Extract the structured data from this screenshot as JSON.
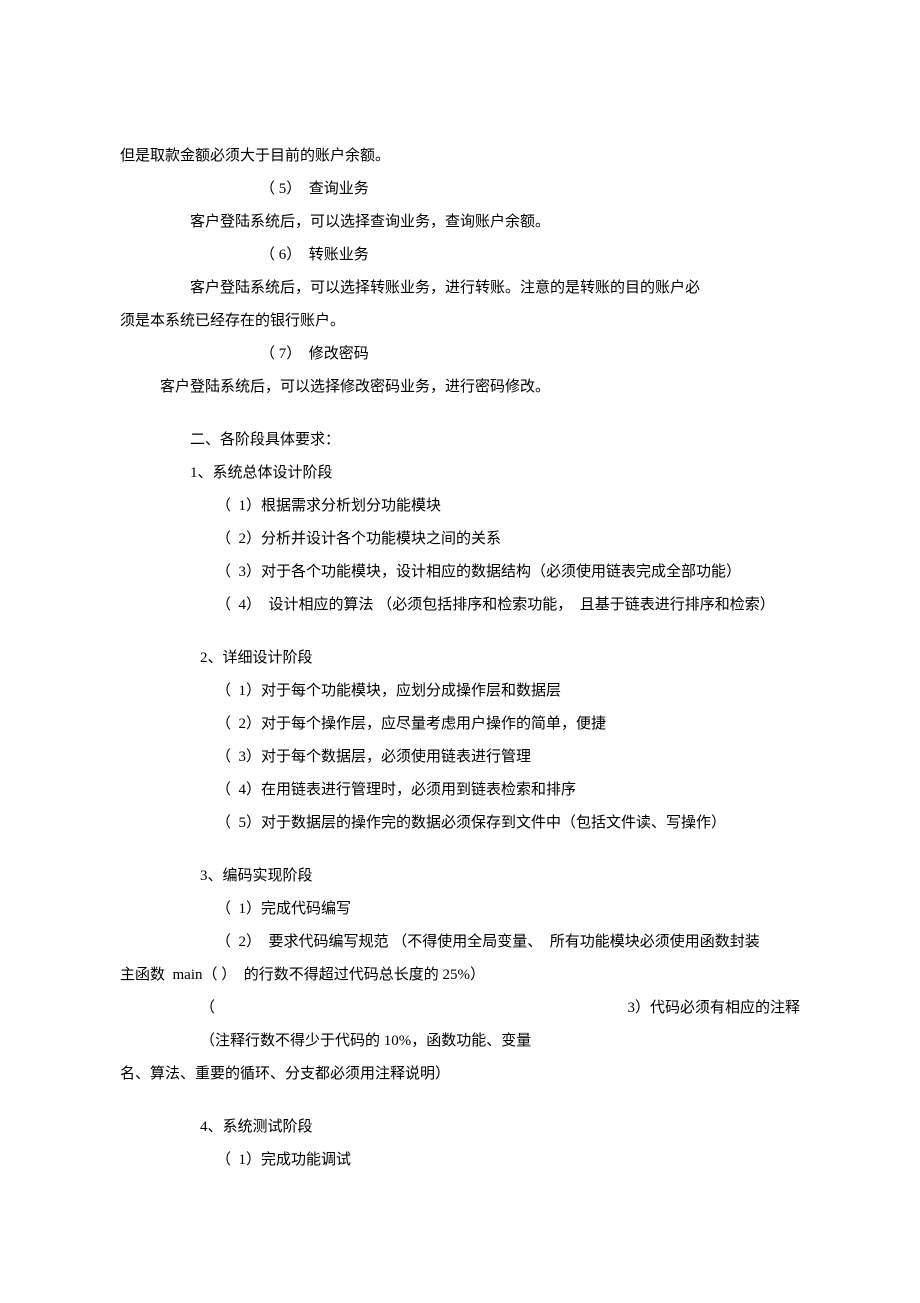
{
  "p1": "但是取款金额必须大于目前的账户余额。",
  "h5": "（ 5）  查询业务",
  "p2": "客户登陆系统后，可以选择查询业务，查询账户余额。",
  "h6": "（ 6）  转账业务",
  "p3a": "客户登陆系统后，可以选择转账业务，进行转账。注意的是转账的目的账户必",
  "p3b": "须是本系统已经存在的银行账户。",
  "h7": "（ 7）  修改密码",
  "p4": "客户登陆系统后，可以选择修改密码业务，进行密码修改。",
  "sec2": "二、各阶段具体要求：",
  "s1": "1、系统总体设计阶段",
  "s1_1": "（  1）根据需求分析划分功能模块",
  "s1_2": "（  2）分析并设计各个功能模块之间的关系",
  "s1_3": "（  3）对于各个功能模块，设计相应的数据结构（必须使用链表完成全部功能）",
  "s1_4": "（  4）  设计相应的算法 （必须包括排序和检索功能，  且基于链表进行排序和检索）",
  "s2": "2、详细设计阶段",
  "s2_1": "（  1）对于每个功能模块，应划分成操作层和数据层",
  "s2_2": "（  2）对于每个操作层，应尽量考虑用户操作的简单，便捷",
  "s2_3": "（  3）对于每个数据层，必须使用链表进行管理",
  "s2_4": "（  4）在用链表进行管理时，必须用到链表检索和排序",
  "s2_5": "（  5）对于数据层的操作完的数据必须保存到文件中（包括文件读、写操作）",
  "s3": "3、编码实现阶段",
  "s3_1": "（  1）完成代码编写",
  "s3_2a": "（  2）  要求代码编写规范 （不得使用全局变量、  所有功能模块必须使用函数封装",
  "s3_2b": "主函数  main（ ）  的行数不得超过代码总长度的 25%）",
  "s3_lparen": "（",
  "s3_3r": "3）代码必须有相应的注释",
  "s3_3note": "（注释行数不得少于代码的 10%，函数功能、变量",
  "s3_3last": "名、算法、重要的循环、分支都必须用注释说明）",
  "s4": "4、系统测试阶段",
  "s4_1": "（  1）完成功能调试"
}
